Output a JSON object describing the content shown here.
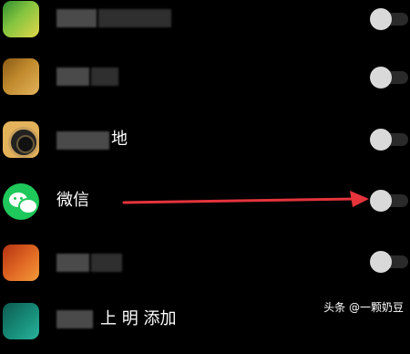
{
  "app_permissions": {
    "items": [
      {
        "name": "",
        "icon": "green-yellow-app-icon",
        "enabled": false
      },
      {
        "name": "",
        "icon": "gold-app-icon",
        "enabled": false
      },
      {
        "name": "地",
        "icon": "camera-app-icon",
        "enabled": false
      },
      {
        "name": "微信",
        "icon": "wechat-icon",
        "enabled": false
      },
      {
        "name": "",
        "icon": "orange-app-icon",
        "enabled": false
      },
      {
        "name": "上  明  添加",
        "icon": "teal-app-icon",
        "enabled": false
      }
    ]
  },
  "annotation": {
    "arrow_color": "#e5343c",
    "points_to": "wechat-toggle"
  },
  "watermark": {
    "text": "头条 @一颗奶豆"
  }
}
